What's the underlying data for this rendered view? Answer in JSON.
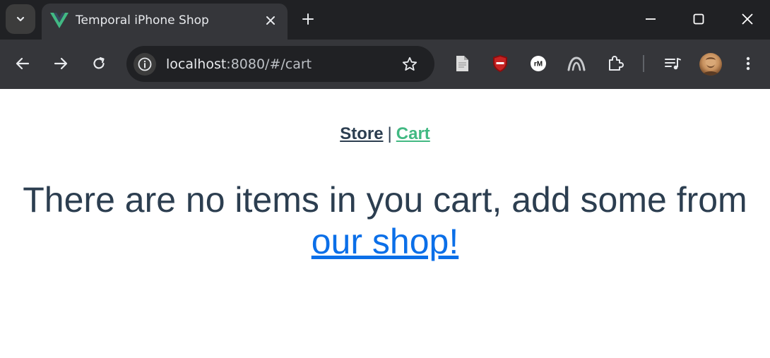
{
  "browser": {
    "tab": {
      "title": "Temporal iPhone Shop",
      "favicon": "vue-logo-icon"
    },
    "address_bar": {
      "host": "localhost",
      "path": ":8080/#/cart"
    },
    "extensions": [
      "document-icon",
      "shield-block-icon",
      "rm-extension-icon",
      "arc-extension-icon",
      "puzzle-icon"
    ],
    "accent_colors": {
      "vue_green": "#42b983",
      "chrome_dark": "#202124",
      "toolbar": "#35363a"
    }
  },
  "page": {
    "nav": {
      "store_label": "Store",
      "separator": "|",
      "cart_label": "Cart"
    },
    "empty_cart": {
      "message": "There are no items in you cart, add some from",
      "link_text": "our shop!"
    },
    "colors": {
      "text": "#2c3e50",
      "active_link": "#42b983",
      "link": "#0b6fe8"
    }
  }
}
